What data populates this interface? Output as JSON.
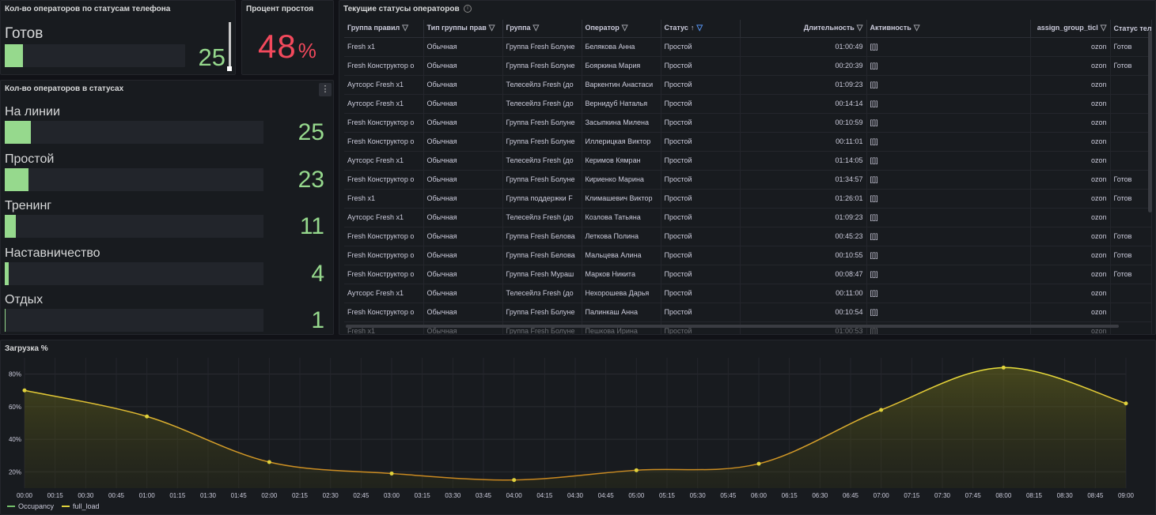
{
  "colors": {
    "green": "#96d98d",
    "red": "#f2495c",
    "yellow": "#e0d23c",
    "orange": "#e39a2a",
    "blue": "#5794f2"
  },
  "phone_panel": {
    "title": "Кол-во операторов по статусам телефона",
    "label": "Готов",
    "value": "25",
    "fill_fraction": 0.1
  },
  "idle_panel": {
    "title": "Процент простоя",
    "value": "48",
    "unit": "%"
  },
  "status_panel": {
    "title": "Кол-во операторов в статусах",
    "menu_icon": "kebab-menu-icon",
    "rows": [
      {
        "label": "На линии",
        "value": "25",
        "fill_fraction": 0.1
      },
      {
        "label": "Простой",
        "value": "23",
        "fill_fraction": 0.092
      },
      {
        "label": "Тренинг",
        "value": "11",
        "fill_fraction": 0.044
      },
      {
        "label": "Наставничество",
        "value": "4",
        "fill_fraction": 0.016
      },
      {
        "label": "Отдых",
        "value": "1",
        "fill_fraction": 0.004
      }
    ]
  },
  "table_panel": {
    "title": "Текущие статусы операторов",
    "info_icon": "info-icon",
    "columns": [
      "Группа правил",
      "Тип группы прав",
      "Группа",
      "Оператор",
      "Статус",
      "Длительность",
      "Активность",
      "assign_group_ticl",
      "Статус теле"
    ],
    "rows": [
      [
        "Fresh x1",
        "Обычная",
        "Группа Fresh Болуне",
        "Белякова Анна",
        "Простой",
        "01:00:49",
        "[[]]",
        "ozon",
        "Готов"
      ],
      [
        "Fresh Конструктор о",
        "Обычная",
        "Группа Fresh Болуне",
        "Бояркина Мария",
        "Простой",
        "00:20:39",
        "[[]]",
        "ozon",
        "Готов"
      ],
      [
        "Аутсорс Fresh x1",
        "Обычная",
        "Телесейлз Fresh (до",
        "Варкентин Анастаси",
        "Простой",
        "01:09:23",
        "[[]]",
        "ozon",
        ""
      ],
      [
        "Аутсорс Fresh x1",
        "Обычная",
        "Телесейлз Fresh (до",
        "Вернидуб Наталья",
        "Простой",
        "00:14:14",
        "[[]]",
        "ozon",
        ""
      ],
      [
        "Fresh Конструктор о",
        "Обычная",
        "Группа Fresh Болуне",
        "Засыпкина Милена",
        "Простой",
        "00:10:59",
        "[[]]",
        "ozon",
        ""
      ],
      [
        "Fresh Конструктор о",
        "Обычная",
        "Группа Fresh Болуне",
        "Иллерицкая Виктор",
        "Простой",
        "00:11:01",
        "[[]]",
        "ozon",
        ""
      ],
      [
        "Аутсорс Fresh x1",
        "Обычная",
        "Телесейлз Fresh (до",
        "Керимов Кямран",
        "Простой",
        "01:14:05",
        "[[]]",
        "ozon",
        ""
      ],
      [
        "Fresh Конструктор о",
        "Обычная",
        "Группа Fresh Болуне",
        "Кириенко Марина",
        "Простой",
        "01:34:57",
        "[[]]",
        "ozon",
        "Готов"
      ],
      [
        "Fresh x1",
        "Обычная",
        "Группа поддержки F",
        "Климашевич Виктор",
        "Простой",
        "01:26:01",
        "[[]]",
        "ozon",
        "Готов"
      ],
      [
        "Аутсорс Fresh x1",
        "Обычная",
        "Телесейлз Fresh (до",
        "Козлова Татьяна",
        "Простой",
        "01:09:23",
        "[[]]",
        "ozon",
        ""
      ],
      [
        "Fresh Конструктор о",
        "Обычная",
        "Группа Fresh Белова",
        "Леткова Полина",
        "Простой",
        "00:45:23",
        "[[]]",
        "ozon",
        "Готов"
      ],
      [
        "Fresh Конструктор о",
        "Обычная",
        "Группа Fresh Белова",
        "Мальцева Алина",
        "Простой",
        "00:10:55",
        "[[]]",
        "ozon",
        "Готов"
      ],
      [
        "Fresh Конструктор о",
        "Обычная",
        "Группа Fresh Мураш",
        "Марков Никита",
        "Простой",
        "00:08:47",
        "[[]]",
        "ozon",
        "Готов"
      ],
      [
        "Аутсорс Fresh x1",
        "Обычная",
        "Телесейлз Fresh (до",
        "Нехорошева Дарья",
        "Простой",
        "00:11:00",
        "[[]]",
        "ozon",
        ""
      ],
      [
        "Fresh Конструктор о",
        "Обычная",
        "Группа Fresh Болуне",
        "Палинкаш Анна",
        "Простой",
        "00:10:54",
        "[[]]",
        "ozon",
        ""
      ],
      [
        "Fresh x1",
        "Обычная",
        "Группа Fresh Болуне",
        "Пешкова Ирина",
        "Простой",
        "01:00:53",
        "[[]]",
        "ozon",
        ""
      ]
    ]
  },
  "chart_panel": {
    "title": "Загрузка %",
    "chart_data": {
      "type": "area",
      "title": "Загрузка %",
      "x": [
        "00:00",
        "00:15",
        "00:30",
        "00:45",
        "01:00",
        "01:15",
        "01:30",
        "01:45",
        "02:00",
        "02:15",
        "02:30",
        "02:45",
        "03:00",
        "03:15",
        "03:30",
        "03:45",
        "04:00",
        "04:15",
        "04:30",
        "04:45",
        "05:00",
        "05:15",
        "05:30",
        "05:45",
        "06:00",
        "06:15",
        "06:30",
        "06:45",
        "07:00",
        "07:15",
        "07:30",
        "07:45",
        "08:00",
        "08:15",
        "08:30",
        "08:45",
        "09:00"
      ],
      "y_ticks": [
        "20%",
        "40%",
        "60%",
        "80%"
      ],
      "ylim": [
        10,
        90
      ],
      "series": [
        {
          "name": "Occupancy",
          "color": "#73bf69",
          "points": []
        },
        {
          "name": "full_load",
          "color": "#e0d23c",
          "points": [
            {
              "x": "00:00",
              "y": 70
            },
            {
              "x": "01:00",
              "y": 54
            },
            {
              "x": "02:00",
              "y": 26
            },
            {
              "x": "03:00",
              "y": 19
            },
            {
              "x": "04:00",
              "y": 15
            },
            {
              "x": "05:00",
              "y": 21
            },
            {
              "x": "06:00",
              "y": 25
            },
            {
              "x": "07:00",
              "y": 58
            },
            {
              "x": "08:00",
              "y": 84
            },
            {
              "x": "09:00",
              "y": 62
            }
          ]
        }
      ],
      "legend_position": "bottom-left",
      "grid": true
    }
  }
}
